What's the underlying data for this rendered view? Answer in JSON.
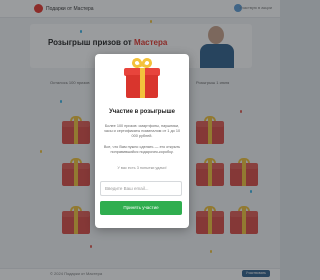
{
  "header": {
    "logo_text": "Подарки от Мастера",
    "user_text": "Участвую в акции"
  },
  "banner": {
    "title_main": "Розыгрыш призов от ",
    "title_accent": "Мастера"
  },
  "info": {
    "left": "Осталось 100 призов",
    "right": "Розыгрыш 1 июля"
  },
  "footer": {
    "left": "© 2024 Подарки от Мастера",
    "button": "Участвовать"
  },
  "modal": {
    "title": "Участие в розыгрыше",
    "description": "Более 100 призов: смартфоны, наушники, часы и сертификаты номиналом от 1 до 10 000 рублей.",
    "description2": "Все, что Вам нужно сделать — это открыть понравившийся подарочек-коробку.",
    "chances": "У вас есть 3 попытки удачи!",
    "email_placeholder": "Введите Ваш email...",
    "submit_label": "Принять участие"
  },
  "colors": {
    "brand": "#e5332a",
    "button": "#2fae4f",
    "gift_red": "#d9352d",
    "ribbon": "#f3c23c"
  }
}
